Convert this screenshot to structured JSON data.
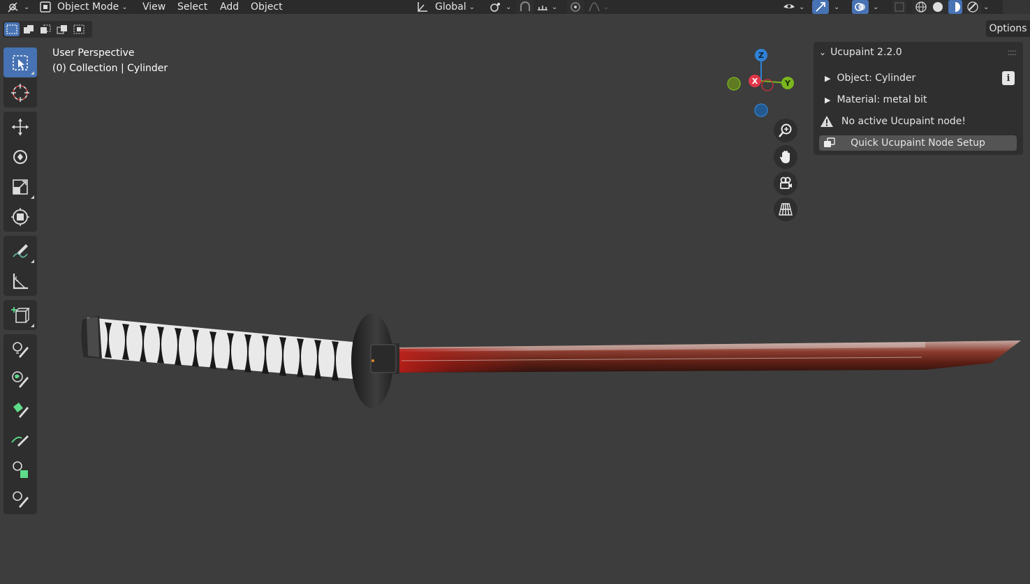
{
  "header": {
    "mode_label": "Object Mode",
    "menus": [
      "View",
      "Select",
      "Add",
      "Object"
    ],
    "transform_orientation": "Global"
  },
  "options_label": "Options",
  "viewport": {
    "perspective_label": "User Perspective",
    "collection_label": "(0) Collection | Cylinder"
  },
  "gizmo": {
    "x": "X",
    "y": "Y",
    "z": "Z"
  },
  "panel": {
    "title": "Ucupaint 2.2.0",
    "object_label": "Object: Cylinder",
    "material_label": "Material: metal bit",
    "warning": "No active Ucupaint node!",
    "quick_setup": "Quick Ucupaint Node Setup"
  },
  "colors": {
    "accent": "#4772b3",
    "axis_x": "#e0364a",
    "axis_y": "#7ab51d",
    "axis_z": "#2f83d6"
  }
}
